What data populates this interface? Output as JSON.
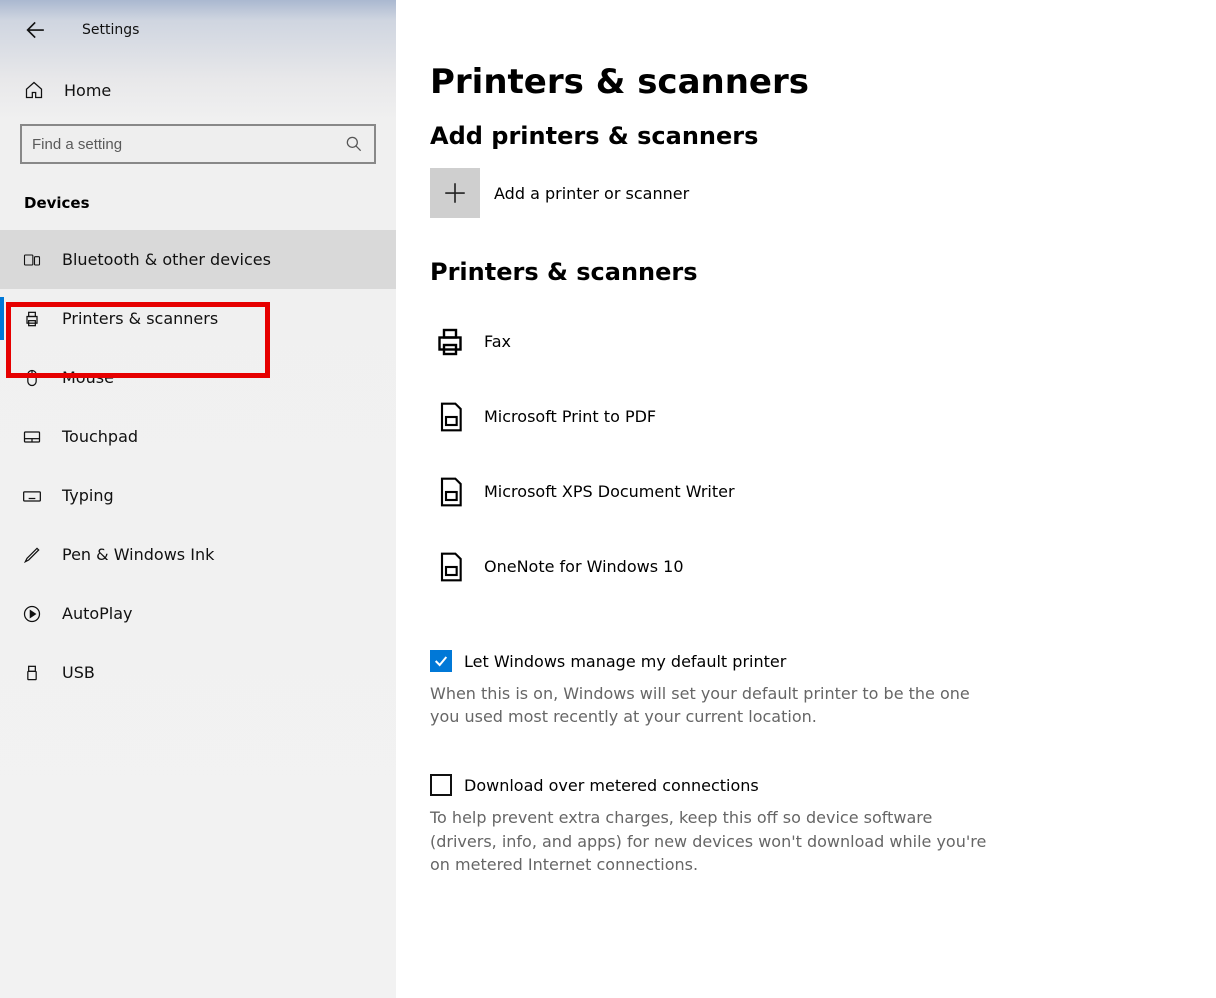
{
  "app_title": "Settings",
  "home_label": "Home",
  "search_placeholder": "Find a setting",
  "category_label": "Devices",
  "nav": [
    {
      "label": "Bluetooth & other devices"
    },
    {
      "label": "Printers & scanners"
    },
    {
      "label": "Mouse"
    },
    {
      "label": "Touchpad"
    },
    {
      "label": "Typing"
    },
    {
      "label": "Pen & Windows Ink"
    },
    {
      "label": "AutoPlay"
    },
    {
      "label": "USB"
    }
  ],
  "page_title": "Printers & scanners",
  "section_add_title": "Add printers & scanners",
  "add_label": "Add a printer or scanner",
  "section_list_title": "Printers & scanners",
  "devices": [
    {
      "label": "Fax"
    },
    {
      "label": "Microsoft Print to PDF"
    },
    {
      "label": "Microsoft XPS Document Writer"
    },
    {
      "label": "OneNote for Windows 10"
    }
  ],
  "default_checkbox_label": "Let Windows manage my default printer",
  "default_checkbox_desc": "When this is on, Windows will set your default printer to be the one you used most recently at your current location.",
  "metered_checkbox_label": "Download over metered connections",
  "metered_checkbox_desc": "To help prevent extra charges, keep this off so device software (drivers, info, and apps) for new devices won't download while you're on metered Internet connections."
}
